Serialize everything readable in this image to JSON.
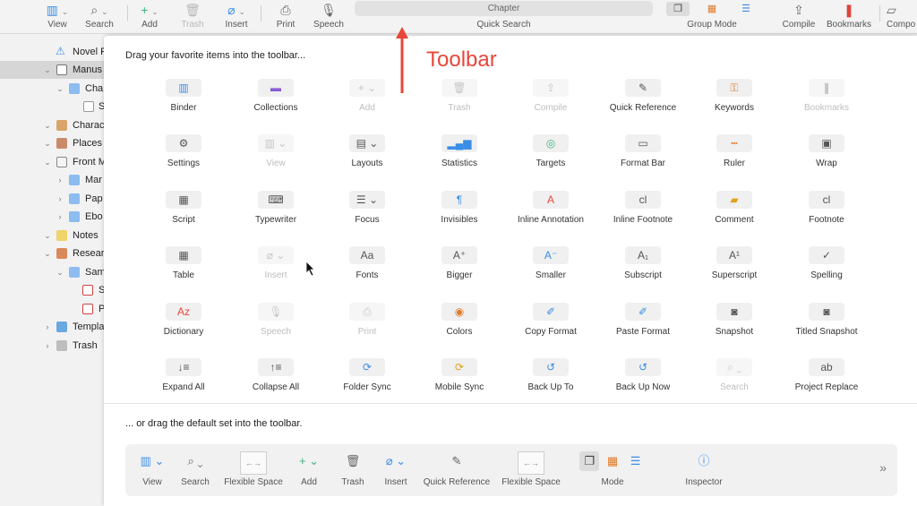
{
  "toolbar": {
    "view": "View",
    "search": "Search",
    "add": "Add",
    "trash": "Trash",
    "insert": "Insert",
    "print": "Print",
    "speech": "Speech",
    "quick_search_value": "Chapter",
    "quick_search": "Quick Search",
    "group_mode": "Group Mode",
    "compile": "Compile",
    "bookmarks": "Bookmarks",
    "compose": "Compo"
  },
  "binder": {
    "items": [
      {
        "label": "Novel F"
      },
      {
        "label": "Manus"
      },
      {
        "label": "Cha"
      },
      {
        "label": "S"
      },
      {
        "label": "Charac"
      },
      {
        "label": "Places"
      },
      {
        "label": "Front M"
      },
      {
        "label": "Mar"
      },
      {
        "label": "Pap"
      },
      {
        "label": "Ebo"
      },
      {
        "label": "Notes"
      },
      {
        "label": "Resear"
      },
      {
        "label": "Sam"
      },
      {
        "label": "S"
      },
      {
        "label": "P"
      },
      {
        "label": "Templa"
      },
      {
        "label": "Trash"
      }
    ]
  },
  "sheet": {
    "intro": "Drag your favorite items into the toolbar...",
    "items": [
      {
        "label": "Binder",
        "icon": "binder-icon",
        "glyph": "▥"
      },
      {
        "label": "Collections",
        "icon": "collections-icon",
        "glyph": "▬"
      },
      {
        "label": "Add",
        "icon": "add-icon",
        "glyph": "+ ⌄"
      },
      {
        "label": "Trash",
        "icon": "trash-icon",
        "glyph": "🗑"
      },
      {
        "label": "Compile",
        "icon": "compile-icon",
        "glyph": "⇪"
      },
      {
        "label": "Quick Reference",
        "icon": "quick-reference-icon",
        "glyph": "✎"
      },
      {
        "label": "Keywords",
        "icon": "keywords-icon",
        "glyph": "⚿"
      },
      {
        "label": "Bookmarks",
        "icon": "bookmarks-icon",
        "glyph": "❚"
      },
      {
        "label": "Settings",
        "icon": "settings-icon",
        "glyph": "⚙"
      },
      {
        "label": "View",
        "icon": "view-icon",
        "glyph": "▥ ⌄"
      },
      {
        "label": "Layouts",
        "icon": "layouts-icon",
        "glyph": "▤ ⌄"
      },
      {
        "label": "Statistics",
        "icon": "statistics-icon",
        "glyph": "▂▄▆"
      },
      {
        "label": "Targets",
        "icon": "targets-icon",
        "glyph": "◎"
      },
      {
        "label": "Format Bar",
        "icon": "format-bar-icon",
        "glyph": "▭"
      },
      {
        "label": "Ruler",
        "icon": "ruler-icon",
        "glyph": "┅"
      },
      {
        "label": "Wrap",
        "icon": "wrap-icon",
        "glyph": "▣"
      },
      {
        "label": "Script",
        "icon": "script-icon",
        "glyph": "▦"
      },
      {
        "label": "Typewriter",
        "icon": "typewriter-icon",
        "glyph": "⌨"
      },
      {
        "label": "Focus",
        "icon": "focus-icon",
        "glyph": "☰ ⌄"
      },
      {
        "label": "Invisibles",
        "icon": "invisibles-icon",
        "glyph": "¶"
      },
      {
        "label": "Inline Annotation",
        "icon": "inline-annotation-icon",
        "glyph": "A"
      },
      {
        "label": "Inline Footnote",
        "icon": "inline-footnote-icon",
        "glyph": "cl"
      },
      {
        "label": "Comment",
        "icon": "comment-icon",
        "glyph": "▰"
      },
      {
        "label": "Footnote",
        "icon": "footnote-icon",
        "glyph": "cl"
      },
      {
        "label": "Table",
        "icon": "table-icon",
        "glyph": "▦"
      },
      {
        "label": "Insert",
        "icon": "insert-icon",
        "glyph": "⌀ ⌄"
      },
      {
        "label": "Fonts",
        "icon": "fonts-icon",
        "glyph": "Aa"
      },
      {
        "label": "Bigger",
        "icon": "bigger-icon",
        "glyph": "A⁺"
      },
      {
        "label": "Smaller",
        "icon": "smaller-icon",
        "glyph": "A⁻"
      },
      {
        "label": "Subscript",
        "icon": "subscript-icon",
        "glyph": "A₁"
      },
      {
        "label": "Superscript",
        "icon": "superscript-icon",
        "glyph": "A¹"
      },
      {
        "label": "Spelling",
        "icon": "spelling-icon",
        "glyph": "✓"
      },
      {
        "label": "Dictionary",
        "icon": "dictionary-icon",
        "glyph": "Az"
      },
      {
        "label": "Speech",
        "icon": "speech-icon",
        "glyph": "🎙"
      },
      {
        "label": "Print",
        "icon": "print-icon",
        "glyph": "⎙"
      },
      {
        "label": "Colors",
        "icon": "colors-icon",
        "glyph": "◉"
      },
      {
        "label": "Copy Format",
        "icon": "copy-format-icon",
        "glyph": "✐"
      },
      {
        "label": "Paste Format",
        "icon": "paste-format-icon",
        "glyph": "✐"
      },
      {
        "label": "Snapshot",
        "icon": "snapshot-icon",
        "glyph": "◙"
      },
      {
        "label": "Titled Snapshot",
        "icon": "titled-snapshot-icon",
        "glyph": "◙"
      },
      {
        "label": "Expand All",
        "icon": "expand-all-icon",
        "glyph": "↓≡"
      },
      {
        "label": "Collapse All",
        "icon": "collapse-all-icon",
        "glyph": "↑≡"
      },
      {
        "label": "Folder Sync",
        "icon": "folder-sync-icon",
        "glyph": "⟳"
      },
      {
        "label": "Mobile Sync",
        "icon": "mobile-sync-icon",
        "glyph": "⟳"
      },
      {
        "label": "Back Up To",
        "icon": "back-up-to-icon",
        "glyph": "↺"
      },
      {
        "label": "Back Up Now",
        "icon": "back-up-now-icon",
        "glyph": "↺"
      },
      {
        "label": "Search",
        "icon": "search-icon",
        "glyph": "⌕ ⌄"
      },
      {
        "label": "Project Replace",
        "icon": "project-replace-icon",
        "glyph": "ab"
      }
    ],
    "default_intro": "... or drag the default set into the toolbar.",
    "defaults": [
      {
        "label": "View",
        "glyph": "▥ ⌄"
      },
      {
        "label": "Search",
        "glyph": "⌕ ⌄"
      },
      {
        "label": "Flexible Space",
        "glyph": "←→"
      },
      {
        "label": "Add",
        "glyph": "+ ⌄"
      },
      {
        "label": "Trash",
        "glyph": "🗑"
      },
      {
        "label": "Insert",
        "glyph": "⌀ ⌄"
      },
      {
        "label": "Quick Reference",
        "glyph": "✎"
      },
      {
        "label": "Flexible Space",
        "glyph": "←→"
      },
      {
        "label": "Mode",
        "glyph": ""
      },
      {
        "label": "Inspector",
        "glyph": "ⓘ"
      }
    ]
  },
  "annotation": {
    "label": "Toolbar"
  },
  "colors": {
    "blue": "#3a8ee6",
    "orange": "#e07b2c",
    "red": "#e8473a",
    "purple": "#8b5cd6",
    "green": "#3fb27f",
    "bookmark_red": "#e0443a"
  }
}
